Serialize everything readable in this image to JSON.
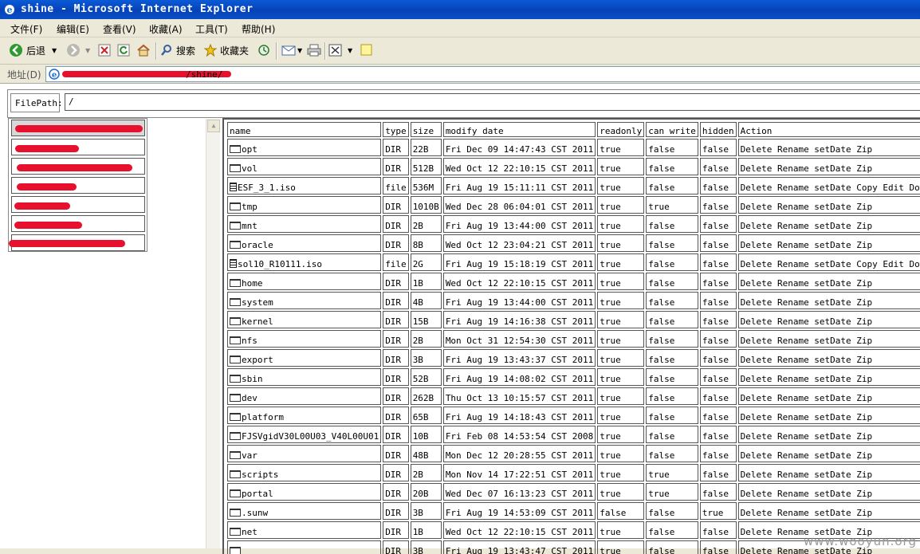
{
  "window": {
    "title": "shine - Microsoft Internet Explorer"
  },
  "menu": [
    "文件(F)",
    "编辑(E)",
    "查看(V)",
    "收藏(A)",
    "工具(T)",
    "帮助(H)"
  ],
  "toolbar": {
    "back": "后退",
    "search": "搜索",
    "favorites": "收藏夹"
  },
  "address": {
    "label": "地址(D)",
    "path": "/shine/"
  },
  "filepath": {
    "label": "FilePath:",
    "value": "/"
  },
  "left_panel": {
    "row_count": 7
  },
  "table": {
    "headers": [
      "name",
      "type",
      "size",
      "modify date",
      "readonly",
      "can write",
      "hidden",
      "Action"
    ],
    "rows": [
      {
        "name": "opt",
        "icon": "folder",
        "type": "DIR",
        "size": "22B",
        "date": "Fri Dec 09 14:47:43 CST 2011",
        "readonly": "true",
        "canwrite": "false",
        "hidden": "false",
        "action": "Delete Rename setDate Zip"
      },
      {
        "name": "vol",
        "icon": "folder",
        "type": "DIR",
        "size": "512B",
        "date": "Wed Oct 12 22:10:15 CST 2011",
        "readonly": "true",
        "canwrite": "false",
        "hidden": "false",
        "action": "Delete Rename setDate Zip"
      },
      {
        "name": "ESF_3_1.iso",
        "icon": "file",
        "type": "file",
        "size": "536M",
        "date": "Fri Aug 19 15:11:11 CST 2011",
        "readonly": "true",
        "canwrite": "false",
        "hidden": "false",
        "action": "Delete Rename setDate Copy Edit Down"
      },
      {
        "name": "tmp",
        "icon": "folder",
        "type": "DIR",
        "size": "1010B",
        "date": "Wed Dec 28 06:04:01 CST 2011",
        "readonly": "true",
        "canwrite": "true",
        "hidden": "false",
        "action": "Delete Rename setDate Zip"
      },
      {
        "name": "mnt",
        "icon": "folder",
        "type": "DIR",
        "size": "2B",
        "date": "Fri Aug 19 13:44:00 CST 2011",
        "readonly": "true",
        "canwrite": "false",
        "hidden": "false",
        "action": "Delete Rename setDate Zip"
      },
      {
        "name": "oracle",
        "icon": "folder",
        "type": "DIR",
        "size": "8B",
        "date": "Wed Oct 12 23:04:21 CST 2011",
        "readonly": "true",
        "canwrite": "false",
        "hidden": "false",
        "action": "Delete Rename setDate Zip"
      },
      {
        "name": "sol10_R10111.iso",
        "icon": "file",
        "type": "file",
        "size": "2G",
        "date": "Fri Aug 19 15:18:19 CST 2011",
        "readonly": "true",
        "canwrite": "false",
        "hidden": "false",
        "action": "Delete Rename setDate Copy Edit Down"
      },
      {
        "name": "home",
        "icon": "folder",
        "type": "DIR",
        "size": "1B",
        "date": "Wed Oct 12 22:10:15 CST 2011",
        "readonly": "true",
        "canwrite": "false",
        "hidden": "false",
        "action": "Delete Rename setDate Zip"
      },
      {
        "name": "system",
        "icon": "folder",
        "type": "DIR",
        "size": "4B",
        "date": "Fri Aug 19 13:44:00 CST 2011",
        "readonly": "true",
        "canwrite": "false",
        "hidden": "false",
        "action": "Delete Rename setDate Zip"
      },
      {
        "name": "kernel",
        "icon": "folder",
        "type": "DIR",
        "size": "15B",
        "date": "Fri Aug 19 14:16:38 CST 2011",
        "readonly": "true",
        "canwrite": "false",
        "hidden": "false",
        "action": "Delete Rename setDate Zip"
      },
      {
        "name": "nfs",
        "icon": "folder",
        "type": "DIR",
        "size": "2B",
        "date": "Mon Oct 31 12:54:30 CST 2011",
        "readonly": "true",
        "canwrite": "false",
        "hidden": "false",
        "action": "Delete Rename setDate Zip"
      },
      {
        "name": "export",
        "icon": "folder",
        "type": "DIR",
        "size": "3B",
        "date": "Fri Aug 19 13:43:37 CST 2011",
        "readonly": "true",
        "canwrite": "false",
        "hidden": "false",
        "action": "Delete Rename setDate Zip"
      },
      {
        "name": "sbin",
        "icon": "folder",
        "type": "DIR",
        "size": "52B",
        "date": "Fri Aug 19 14:08:02 CST 2011",
        "readonly": "true",
        "canwrite": "false",
        "hidden": "false",
        "action": "Delete Rename setDate Zip"
      },
      {
        "name": "dev",
        "icon": "folder",
        "type": "DIR",
        "size": "262B",
        "date": "Thu Oct 13 10:15:57 CST 2011",
        "readonly": "true",
        "canwrite": "false",
        "hidden": "false",
        "action": "Delete Rename setDate Zip"
      },
      {
        "name": "platform",
        "icon": "folder",
        "type": "DIR",
        "size": "65B",
        "date": "Fri Aug 19 14:18:43 CST 2011",
        "readonly": "true",
        "canwrite": "false",
        "hidden": "false",
        "action": "Delete Rename setDate Zip"
      },
      {
        "name": "FJSVgidV30L00U03_V40L00U01",
        "icon": "folder",
        "type": "DIR",
        "size": "10B",
        "date": "Fri Feb 08 14:53:54 CST 2008",
        "readonly": "true",
        "canwrite": "false",
        "hidden": "false",
        "action": "Delete Rename setDate Zip"
      },
      {
        "name": "var",
        "icon": "folder",
        "type": "DIR",
        "size": "48B",
        "date": "Mon Dec 12 20:28:55 CST 2011",
        "readonly": "true",
        "canwrite": "false",
        "hidden": "false",
        "action": "Delete Rename setDate Zip"
      },
      {
        "name": "scripts",
        "icon": "folder",
        "type": "DIR",
        "size": "2B",
        "date": "Mon Nov 14 17:22:51 CST 2011",
        "readonly": "true",
        "canwrite": "true",
        "hidden": "false",
        "action": "Delete Rename setDate Zip"
      },
      {
        "name": "portal",
        "icon": "folder",
        "type": "DIR",
        "size": "20B",
        "date": "Wed Dec 07 16:13:23 CST 2011",
        "readonly": "true",
        "canwrite": "true",
        "hidden": "false",
        "action": "Delete Rename setDate Zip"
      },
      {
        "name": ".sunw",
        "icon": "folder",
        "type": "DIR",
        "size": "3B",
        "date": "Fri Aug 19 14:53:09 CST 2011",
        "readonly": "false",
        "canwrite": "false",
        "hidden": "true",
        "action": "Delete Rename setDate Zip"
      },
      {
        "name": "net",
        "icon": "folder",
        "type": "DIR",
        "size": "1B",
        "date": "Wed Oct 12 22:10:15 CST 2011",
        "readonly": "true",
        "canwrite": "false",
        "hidden": "false",
        "action": "Delete Rename setDate Zip"
      },
      {
        "name": "",
        "icon": "folder",
        "type": "DIR",
        "size": "3B",
        "date": "Fri Aug 19 13:43:47 CST 2011",
        "readonly": "true",
        "canwrite": "false",
        "hidden": "false",
        "action": "Delete Rename setDate Zip"
      }
    ]
  },
  "watermark": "www.wooyun.org",
  "colors": {
    "titlebar": "#0a5bd6",
    "redaction": "#e8112d"
  }
}
